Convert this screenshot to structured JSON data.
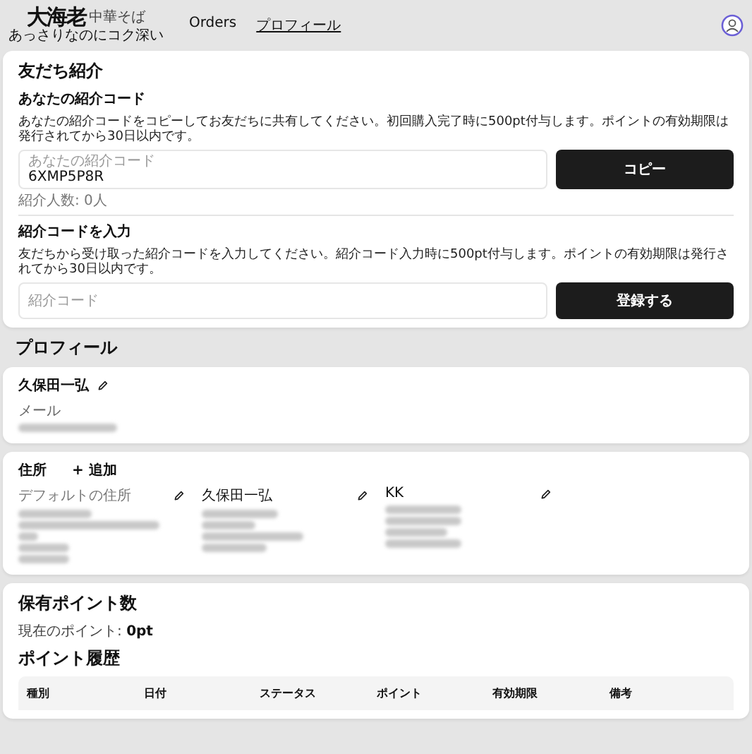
{
  "header": {
    "logo": {
      "main": "大海老",
      "side": "中華そば",
      "tagline": "あっさりなのにコク深い"
    },
    "nav": [
      {
        "label": "Orders",
        "selected": false
      },
      {
        "label": "プロフィール",
        "selected": true
      }
    ]
  },
  "referral": {
    "title": "友だち紹介",
    "own": {
      "heading": "あなたの紹介コード",
      "description": "あなたの紹介コードをコピーしてお友だちに共有してください。初回購入完了時に500pt付与します。ポイントの有効期限は発行されてから30日以内です。",
      "field_label": "あなたの紹介コード",
      "value": "6XMP5P8R",
      "button": "コピー",
      "count": "紹介人数: 0人"
    },
    "enter": {
      "heading": "紹介コードを入力",
      "description": "友だちから受け取った紹介コードを入力してください。紹介コード入力時に500pt付与します。ポイントの有効期限は発行されてから30日以内です。",
      "placeholder": "紹介コード",
      "button": "登録する"
    }
  },
  "profile": {
    "title": "プロフィール",
    "name": "久保田一弘",
    "email_label": "メール",
    "email": {
      "kind": "redacted"
    }
  },
  "addresses": {
    "title": "住所",
    "add": "+ 追加",
    "items": [
      {
        "label": "デフォルトの住所",
        "muted": true,
        "lines": [
          {
            "kind": "redacted"
          },
          {
            "kind": "redacted"
          },
          {
            "kind": "redacted"
          },
          {
            "kind": "redacted"
          },
          {
            "kind": "redacted"
          }
        ]
      },
      {
        "label": "久保田一弘",
        "muted": false,
        "lines": [
          {
            "kind": "redacted"
          },
          {
            "kind": "redacted"
          },
          {
            "kind": "redacted"
          },
          {
            "kind": "redacted"
          }
        ]
      },
      {
        "label": "KK",
        "muted": false,
        "lines": [
          {
            "kind": "redacted"
          },
          {
            "kind": "redacted"
          },
          {
            "kind": "redacted"
          },
          {
            "kind": "redacted"
          }
        ]
      }
    ]
  },
  "points": {
    "title": "保有ポイント数",
    "current_label": "現在のポイント:",
    "current_value": "0pt",
    "history_title": "ポイント履歴",
    "table": {
      "columns": [
        "種別",
        "日付",
        "ステータス",
        "ポイント",
        "有効期限",
        "備考"
      ]
    }
  }
}
